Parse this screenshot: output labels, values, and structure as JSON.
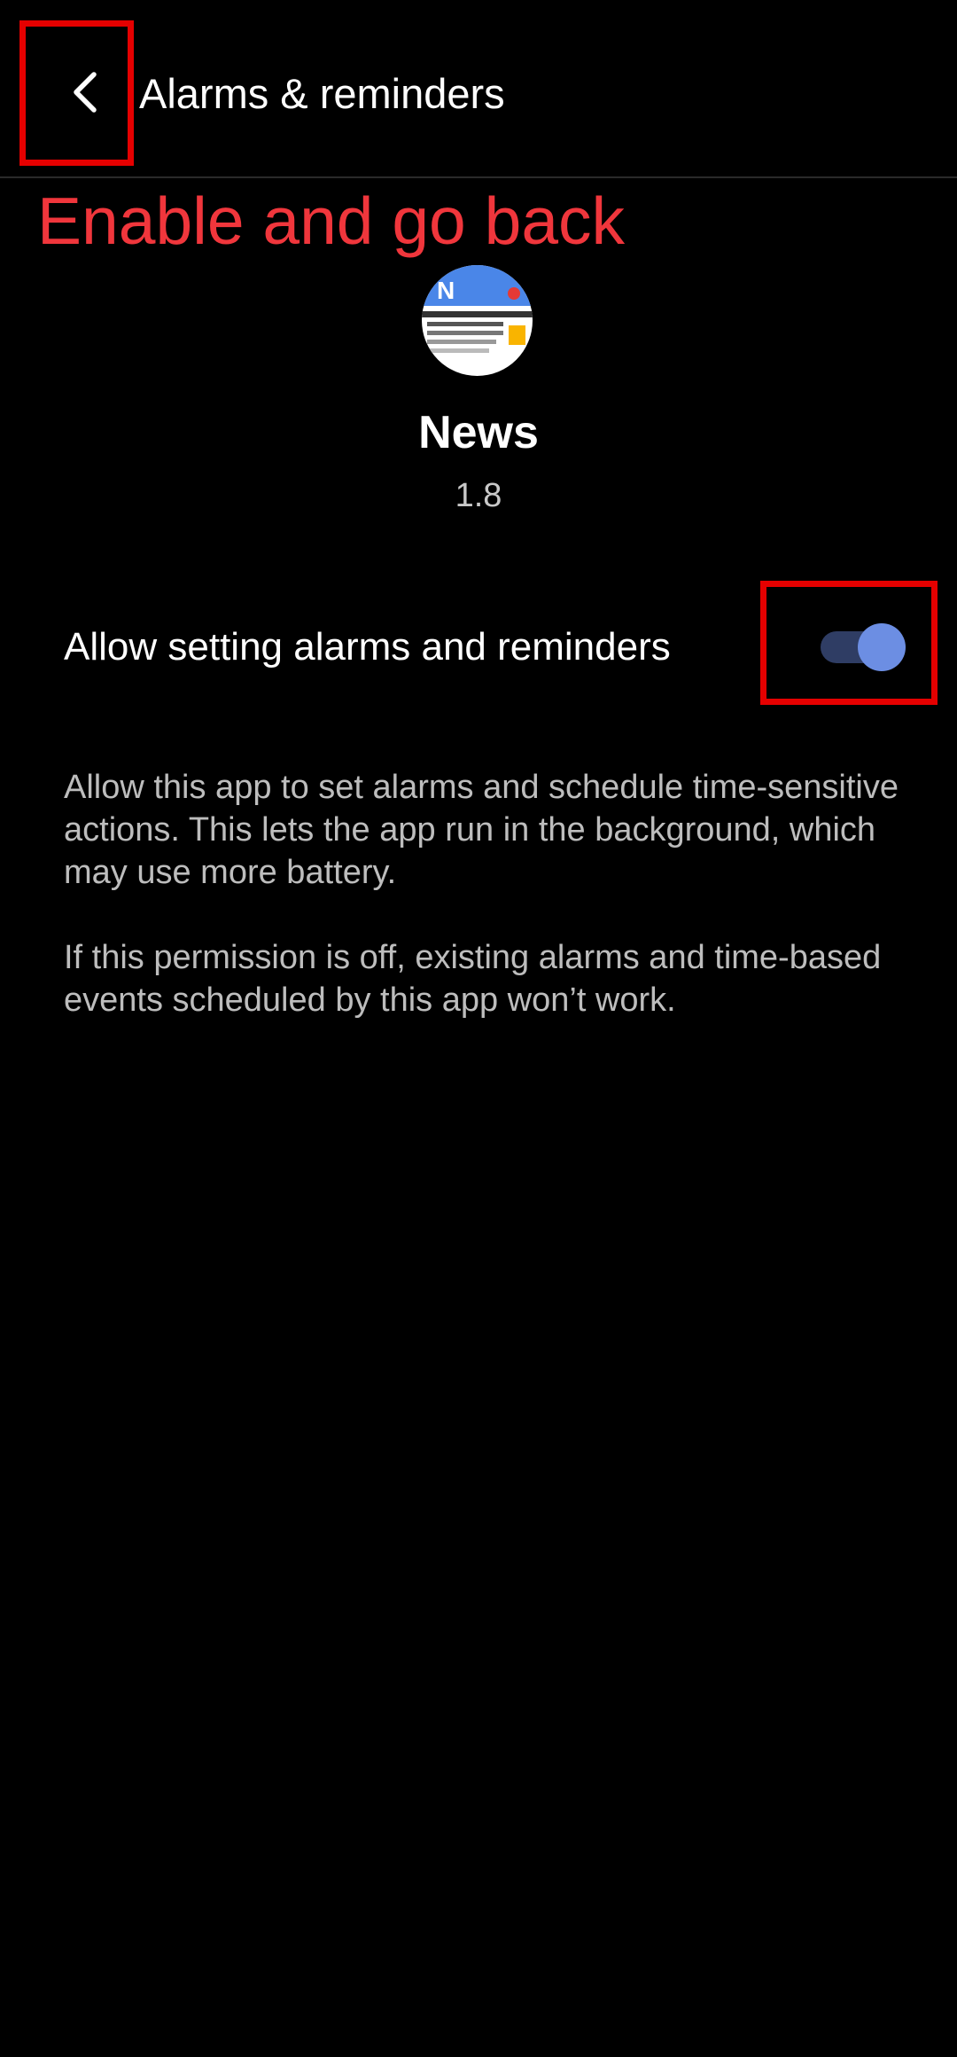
{
  "header": {
    "title": "Alarms & reminders",
    "back_icon": "chevron-left-icon"
  },
  "annotation": {
    "instruction": "Enable and go back",
    "highlight_color": "#e50000",
    "text_color": "#f0363c"
  },
  "app": {
    "icon": "news-app-icon",
    "name": "News",
    "version": "1.8"
  },
  "setting": {
    "label": "Allow setting alarms and reminders",
    "toggle_state": "on",
    "accent_color": "#6c8ee3"
  },
  "description": {
    "paragraph_1": "Allow this app to set alarms and schedule time-sensitive actions. This lets the app run in the background, which may use more battery.",
    "paragraph_2": "If this permission is off, existing alarms and time-based events scheduled by this app won’t work."
  }
}
